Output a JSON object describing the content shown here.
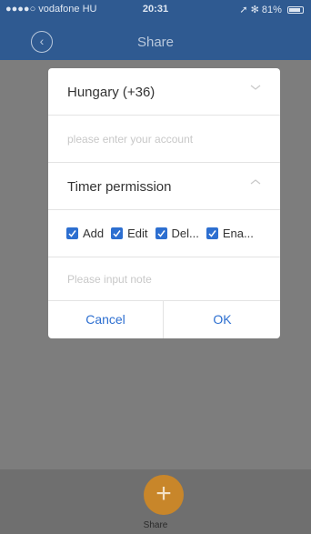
{
  "status_bar": {
    "carrier": "●●●●○ vodafone HU",
    "time": "20:31",
    "battery": "81%"
  },
  "nav": {
    "title": "Share"
  },
  "dialog": {
    "country": "Hungary (+36)",
    "account_placeholder": "please enter your account",
    "permission_title": "Timer permission",
    "permissions": [
      {
        "label": "Add",
        "checked": true
      },
      {
        "label": "Edit",
        "checked": true
      },
      {
        "label": "Del...",
        "checked": true
      },
      {
        "label": "Ena...",
        "checked": true
      }
    ],
    "note_placeholder": "Please input note",
    "cancel_label": "Cancel",
    "ok_label": "OK"
  },
  "bottom": {
    "share_label": "Share"
  },
  "colors": {
    "accent": "#2d6fd0",
    "nav_bg": "#2f5a91",
    "fab": "#c8862a"
  }
}
